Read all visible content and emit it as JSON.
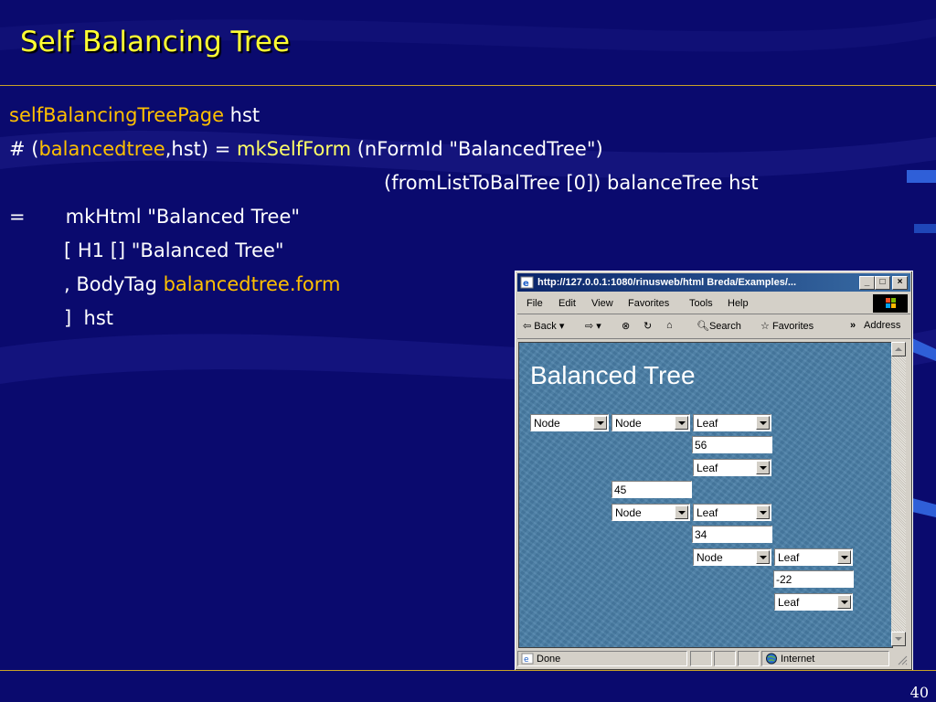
{
  "slide": {
    "title": "Self Balancing Tree",
    "page_number": "40"
  },
  "code": {
    "line1": {
      "fn": "selfBalancingTreePage",
      "rest": " hst"
    },
    "line2": {
      "p1": "# (",
      "var": "balancedtree",
      "p2": ",hst) = ",
      "fn": "mkSelfForm",
      "p3": " (nFormId \"BalancedTree\")"
    },
    "line3": "(fromListToBalTree [0]) balanceTree hst",
    "line4": {
      "eq": "=",
      "text": "mkHtml \"Balanced Tree\""
    },
    "line5": "[ H1 [] \"Balanced Tree\"",
    "line6": {
      "p1": ", BodyTag ",
      "var": "balancedtree.form"
    },
    "line7": "]  hst"
  },
  "browser": {
    "title": "http://127.0.0.1:1080/rinusweb/html Breda/Examples/...",
    "menu": [
      "File",
      "Edit",
      "View",
      "Favorites",
      "Tools",
      "Help"
    ],
    "toolbar": {
      "back": "Back",
      "search": "Search",
      "favorites": "Favorites",
      "more": "»",
      "address": "Address"
    },
    "status": {
      "left": "Done",
      "zone": "Internet"
    },
    "page": {
      "heading": "Balanced Tree",
      "fields": {
        "sel_a": "Node",
        "sel_b": "Node",
        "sel_c": "Leaf",
        "txt_56": "56",
        "sel_d": "Leaf",
        "txt_45": "45",
        "sel_e": "Node",
        "sel_f": "Leaf",
        "txt_34": "34",
        "sel_g": "Node",
        "sel_h": "Leaf",
        "txt_m22": "-22",
        "sel_i": "Leaf"
      }
    }
  }
}
